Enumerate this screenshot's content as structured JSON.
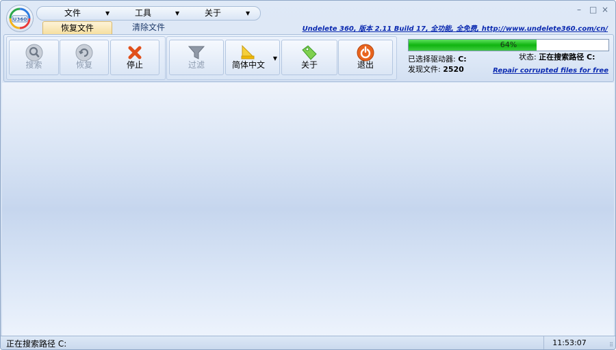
{
  "app": {
    "logo_text": "U360"
  },
  "menu": {
    "items": [
      {
        "label": "文件"
      },
      {
        "label": "工具"
      },
      {
        "label": "关于"
      }
    ]
  },
  "window_controls": {
    "minimize": "–",
    "maximize": "□",
    "close": "×"
  },
  "tabs": [
    {
      "label": "恢复文件",
      "active": true
    },
    {
      "label": "清除文件",
      "active": false
    }
  ],
  "header": {
    "site_link": "Undelete 360, 版本 2.11 Build 17, 全功能, 全免费, http://www.undelete360.com/cn/"
  },
  "toolbar": {
    "search_label": "搜索",
    "recover_label": "恢复",
    "stop_label": "停止",
    "filter_label": "过滤",
    "language_label": "简体中文",
    "about_label": "关于",
    "exit_label": "退出"
  },
  "progress": {
    "value": 0.64,
    "text": "64%"
  },
  "scan_info": {
    "drive_label": "已选择驱动器:",
    "drive_value": "C:",
    "found_label": "发现文件:",
    "found_value": "2520",
    "status_label": "状态:",
    "status_value": "正在搜索路径 C:",
    "repair_link": "Repair corrupted files for free"
  },
  "statusbar": {
    "text": "正在搜索路径  C:",
    "time": "11:53:07"
  },
  "colors": {
    "accent": "#0b2ab0",
    "progress": "#10b510",
    "stop": "#e0501c",
    "exit": "#e8641e"
  }
}
